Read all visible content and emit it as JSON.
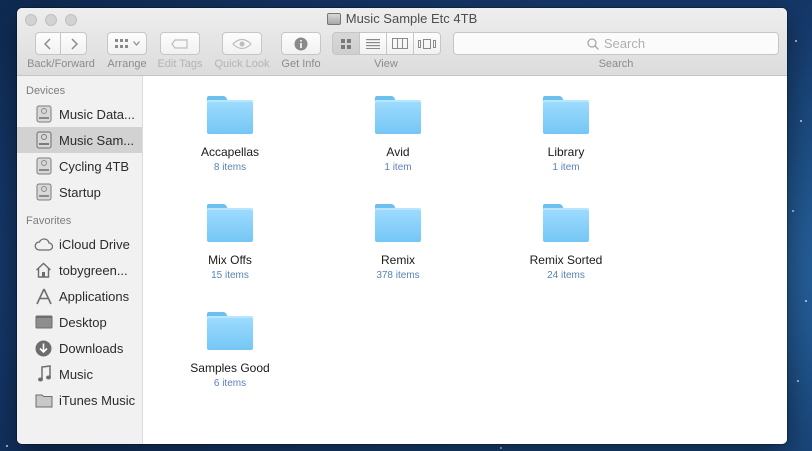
{
  "window": {
    "title": "Music Sample Etc 4TB"
  },
  "toolbar": {
    "back_forward_label": "Back/Forward",
    "arrange_label": "Arrange",
    "edit_tags_label": "Edit Tags",
    "quick_look_label": "Quick Look",
    "get_info_label": "Get Info",
    "view_label": "View",
    "search_placeholder": "Search",
    "search_label": "Search",
    "active_view": "icon"
  },
  "sidebar": {
    "devices_header": "Devices",
    "devices": [
      {
        "label": "Music Data...",
        "icon": "hard-drive-icon"
      },
      {
        "label": "Music Sam...",
        "icon": "hard-drive-icon",
        "selected": true
      },
      {
        "label": "Cycling 4TB",
        "icon": "hard-drive-icon"
      },
      {
        "label": "Startup",
        "icon": "hard-drive-icon"
      }
    ],
    "favorites_header": "Favorites",
    "favorites": [
      {
        "label": "iCloud Drive",
        "icon": "cloud-icon"
      },
      {
        "label": "tobygreen...",
        "icon": "home-icon"
      },
      {
        "label": "Applications",
        "icon": "applications-icon"
      },
      {
        "label": "Desktop",
        "icon": "desktop-icon"
      },
      {
        "label": "Downloads",
        "icon": "downloads-icon"
      },
      {
        "label": "Music",
        "icon": "music-icon"
      },
      {
        "label": "iTunes Music",
        "icon": "folder-icon"
      }
    ]
  },
  "content": {
    "items": [
      {
        "name": "Accapellas",
        "count": "8 items"
      },
      {
        "name": "Avid",
        "count": "1 item"
      },
      {
        "name": "Library",
        "count": "1 item"
      },
      {
        "name": "Mix Offs",
        "count": "15 items"
      },
      {
        "name": "Remix",
        "count": "378 items"
      },
      {
        "name": "Remix Sorted",
        "count": "24 items"
      },
      {
        "name": "Samples Good",
        "count": "6 items"
      }
    ]
  },
  "colors": {
    "folder": "#84cdf7",
    "item_count": "#5b82b8",
    "sidebar_selected": "#d2d2d2",
    "desktop": "#1d4f86"
  }
}
